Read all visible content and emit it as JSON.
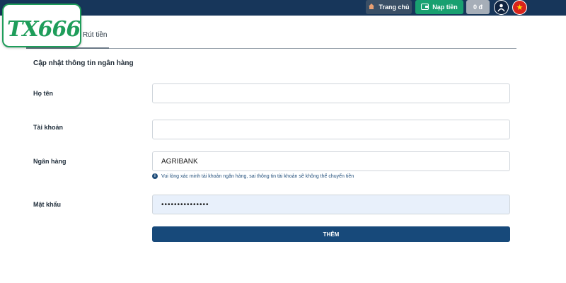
{
  "header": {
    "logo_text": "TX666",
    "home_label": "Trang chủ",
    "deposit_label": "Nạp tiền",
    "balance_label": "0 đ"
  },
  "tab": {
    "label": "Rút tiền"
  },
  "form": {
    "title": "Cập nhật thông tin ngân hàng",
    "name_label": "Họ tên",
    "name_value": "",
    "account_label": "Tài khoản",
    "account_value": "",
    "bank_label": "Ngân hàng",
    "bank_value": "AGRIBANK",
    "bank_hint": "Vui lòng xác minh tài khoản ngân hàng, sai thông tin tài khoản sẽ không thể chuyển tiền",
    "password_label": "Mật khẩu",
    "password_value": "•••••••••••••••",
    "submit_label": "THÊM"
  },
  "colors": {
    "header_bg": "#17365a",
    "brand_green": "#1e9d5a",
    "deposit_green": "#18a070",
    "submit_blue": "#17497a"
  },
  "icons": {
    "home": "house-icon",
    "deposit": "wallet-icon",
    "avatar": "user-avatar-icon",
    "flag": "vietnam-flag-icon",
    "hint": "info-icon"
  }
}
